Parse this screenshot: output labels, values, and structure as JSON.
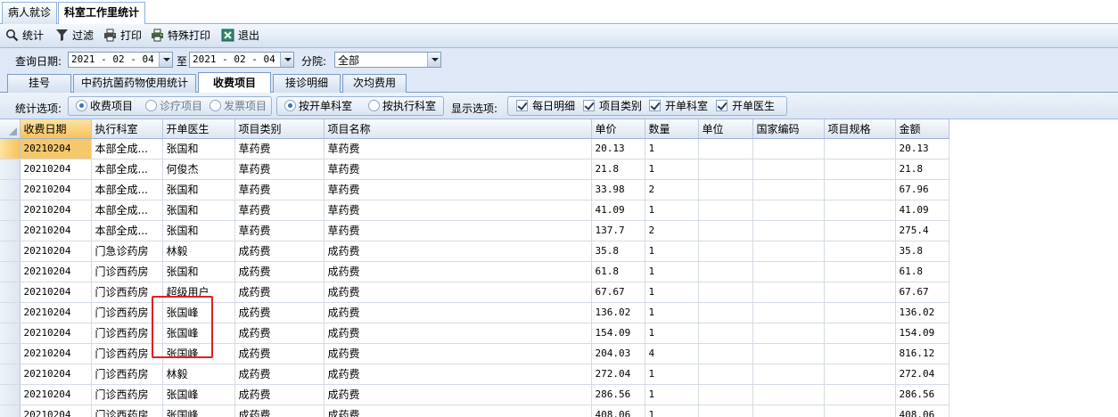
{
  "doc_tabs": [
    {
      "label": "病人就诊",
      "active": false
    },
    {
      "label": "科室工作里统计",
      "active": true
    }
  ],
  "toolbar": {
    "stats": "统计",
    "filter": "过滤",
    "print": "打印",
    "special_print": "特殊打印",
    "exit": "退出"
  },
  "query": {
    "date_label": "查询日期:",
    "start_date": "2021 - 02 - 04",
    "to_label": "至",
    "end_date": "2021 - 02 - 04",
    "branch_label": "分院:",
    "branch_value": "全部"
  },
  "report_tabs": [
    {
      "label": "挂号",
      "active": false
    },
    {
      "label": "中药抗菌药物使用统计",
      "active": false
    },
    {
      "label": "收费项目",
      "active": true
    },
    {
      "label": "接诊明细",
      "active": false
    },
    {
      "label": "次均费用",
      "active": false
    }
  ],
  "options": {
    "stat_label": "统计选项:",
    "stat_radios": [
      {
        "label": "收费项目",
        "checked": true
      },
      {
        "label": "诊疗项目",
        "checked": false
      },
      {
        "label": "发票项目",
        "checked": false
      }
    ],
    "dept_radios": [
      {
        "label": "按开单科室",
        "checked": true
      },
      {
        "label": "按执行科室",
        "checked": false
      }
    ],
    "display_label": "显示选项:",
    "display_checks": [
      {
        "label": "每日明细",
        "checked": true
      },
      {
        "label": "项目类别",
        "checked": true
      },
      {
        "label": "开单科室",
        "checked": true
      },
      {
        "label": "开单医生",
        "checked": true
      }
    ]
  },
  "grid": {
    "columns": [
      "收费日期",
      "执行科室",
      "开单医生",
      "项目类别",
      "项目名称",
      "单价",
      "数量",
      "单位",
      "国家编码",
      "项目规格",
      "金额"
    ],
    "rows": [
      [
        "20210204",
        "本部全成...",
        "张国和",
        "草药费",
        "草药费",
        "20.13",
        "1",
        "",
        "",
        "",
        "20.13"
      ],
      [
        "20210204",
        "本部全成...",
        "何俊杰",
        "草药费",
        "草药费",
        "21.8",
        "1",
        "",
        "",
        "",
        "21.8"
      ],
      [
        "20210204",
        "本部全成...",
        "张国和",
        "草药费",
        "草药费",
        "33.98",
        "2",
        "",
        "",
        "",
        "67.96"
      ],
      [
        "20210204",
        "本部全成...",
        "张国和",
        "草药费",
        "草药费",
        "41.09",
        "1",
        "",
        "",
        "",
        "41.09"
      ],
      [
        "20210204",
        "本部全成...",
        "张国和",
        "草药费",
        "草药费",
        "137.7",
        "2",
        "",
        "",
        "",
        "275.4"
      ],
      [
        "20210204",
        "门急诊药房",
        "林毅",
        "成药费",
        "成药费",
        "35.8",
        "1",
        "",
        "",
        "",
        "35.8"
      ],
      [
        "20210204",
        "门诊西药房",
        "张国和",
        "成药费",
        "成药费",
        "61.8",
        "1",
        "",
        "",
        "",
        "61.8"
      ],
      [
        "20210204",
        "门诊西药房",
        "超级用户",
        "成药费",
        "成药费",
        "67.67",
        "1",
        "",
        "",
        "",
        "67.67"
      ],
      [
        "20210204",
        "门诊西药房",
        "张国峰",
        "成药费",
        "成药费",
        "136.02",
        "1",
        "",
        "",
        "",
        "136.02"
      ],
      [
        "20210204",
        "门诊西药房",
        "张国峰",
        "成药费",
        "成药费",
        "154.09",
        "1",
        "",
        "",
        "",
        "154.09"
      ],
      [
        "20210204",
        "门诊西药房",
        "张国峰",
        "成药费",
        "成药费",
        "204.03",
        "4",
        "",
        "",
        "",
        "816.12"
      ],
      [
        "20210204",
        "门诊西药房",
        "林毅",
        "成药费",
        "成药费",
        "272.04",
        "1",
        "",
        "",
        "",
        "272.04"
      ],
      [
        "20210204",
        "门诊西药房",
        "张国峰",
        "成药费",
        "成药费",
        "286.56",
        "1",
        "",
        "",
        "",
        "286.56"
      ],
      [
        "20210204",
        "门诊西药房",
        "张国峰",
        "成药费",
        "成药费",
        "408.06",
        "1",
        "",
        "",
        "",
        "408.06"
      ]
    ]
  }
}
